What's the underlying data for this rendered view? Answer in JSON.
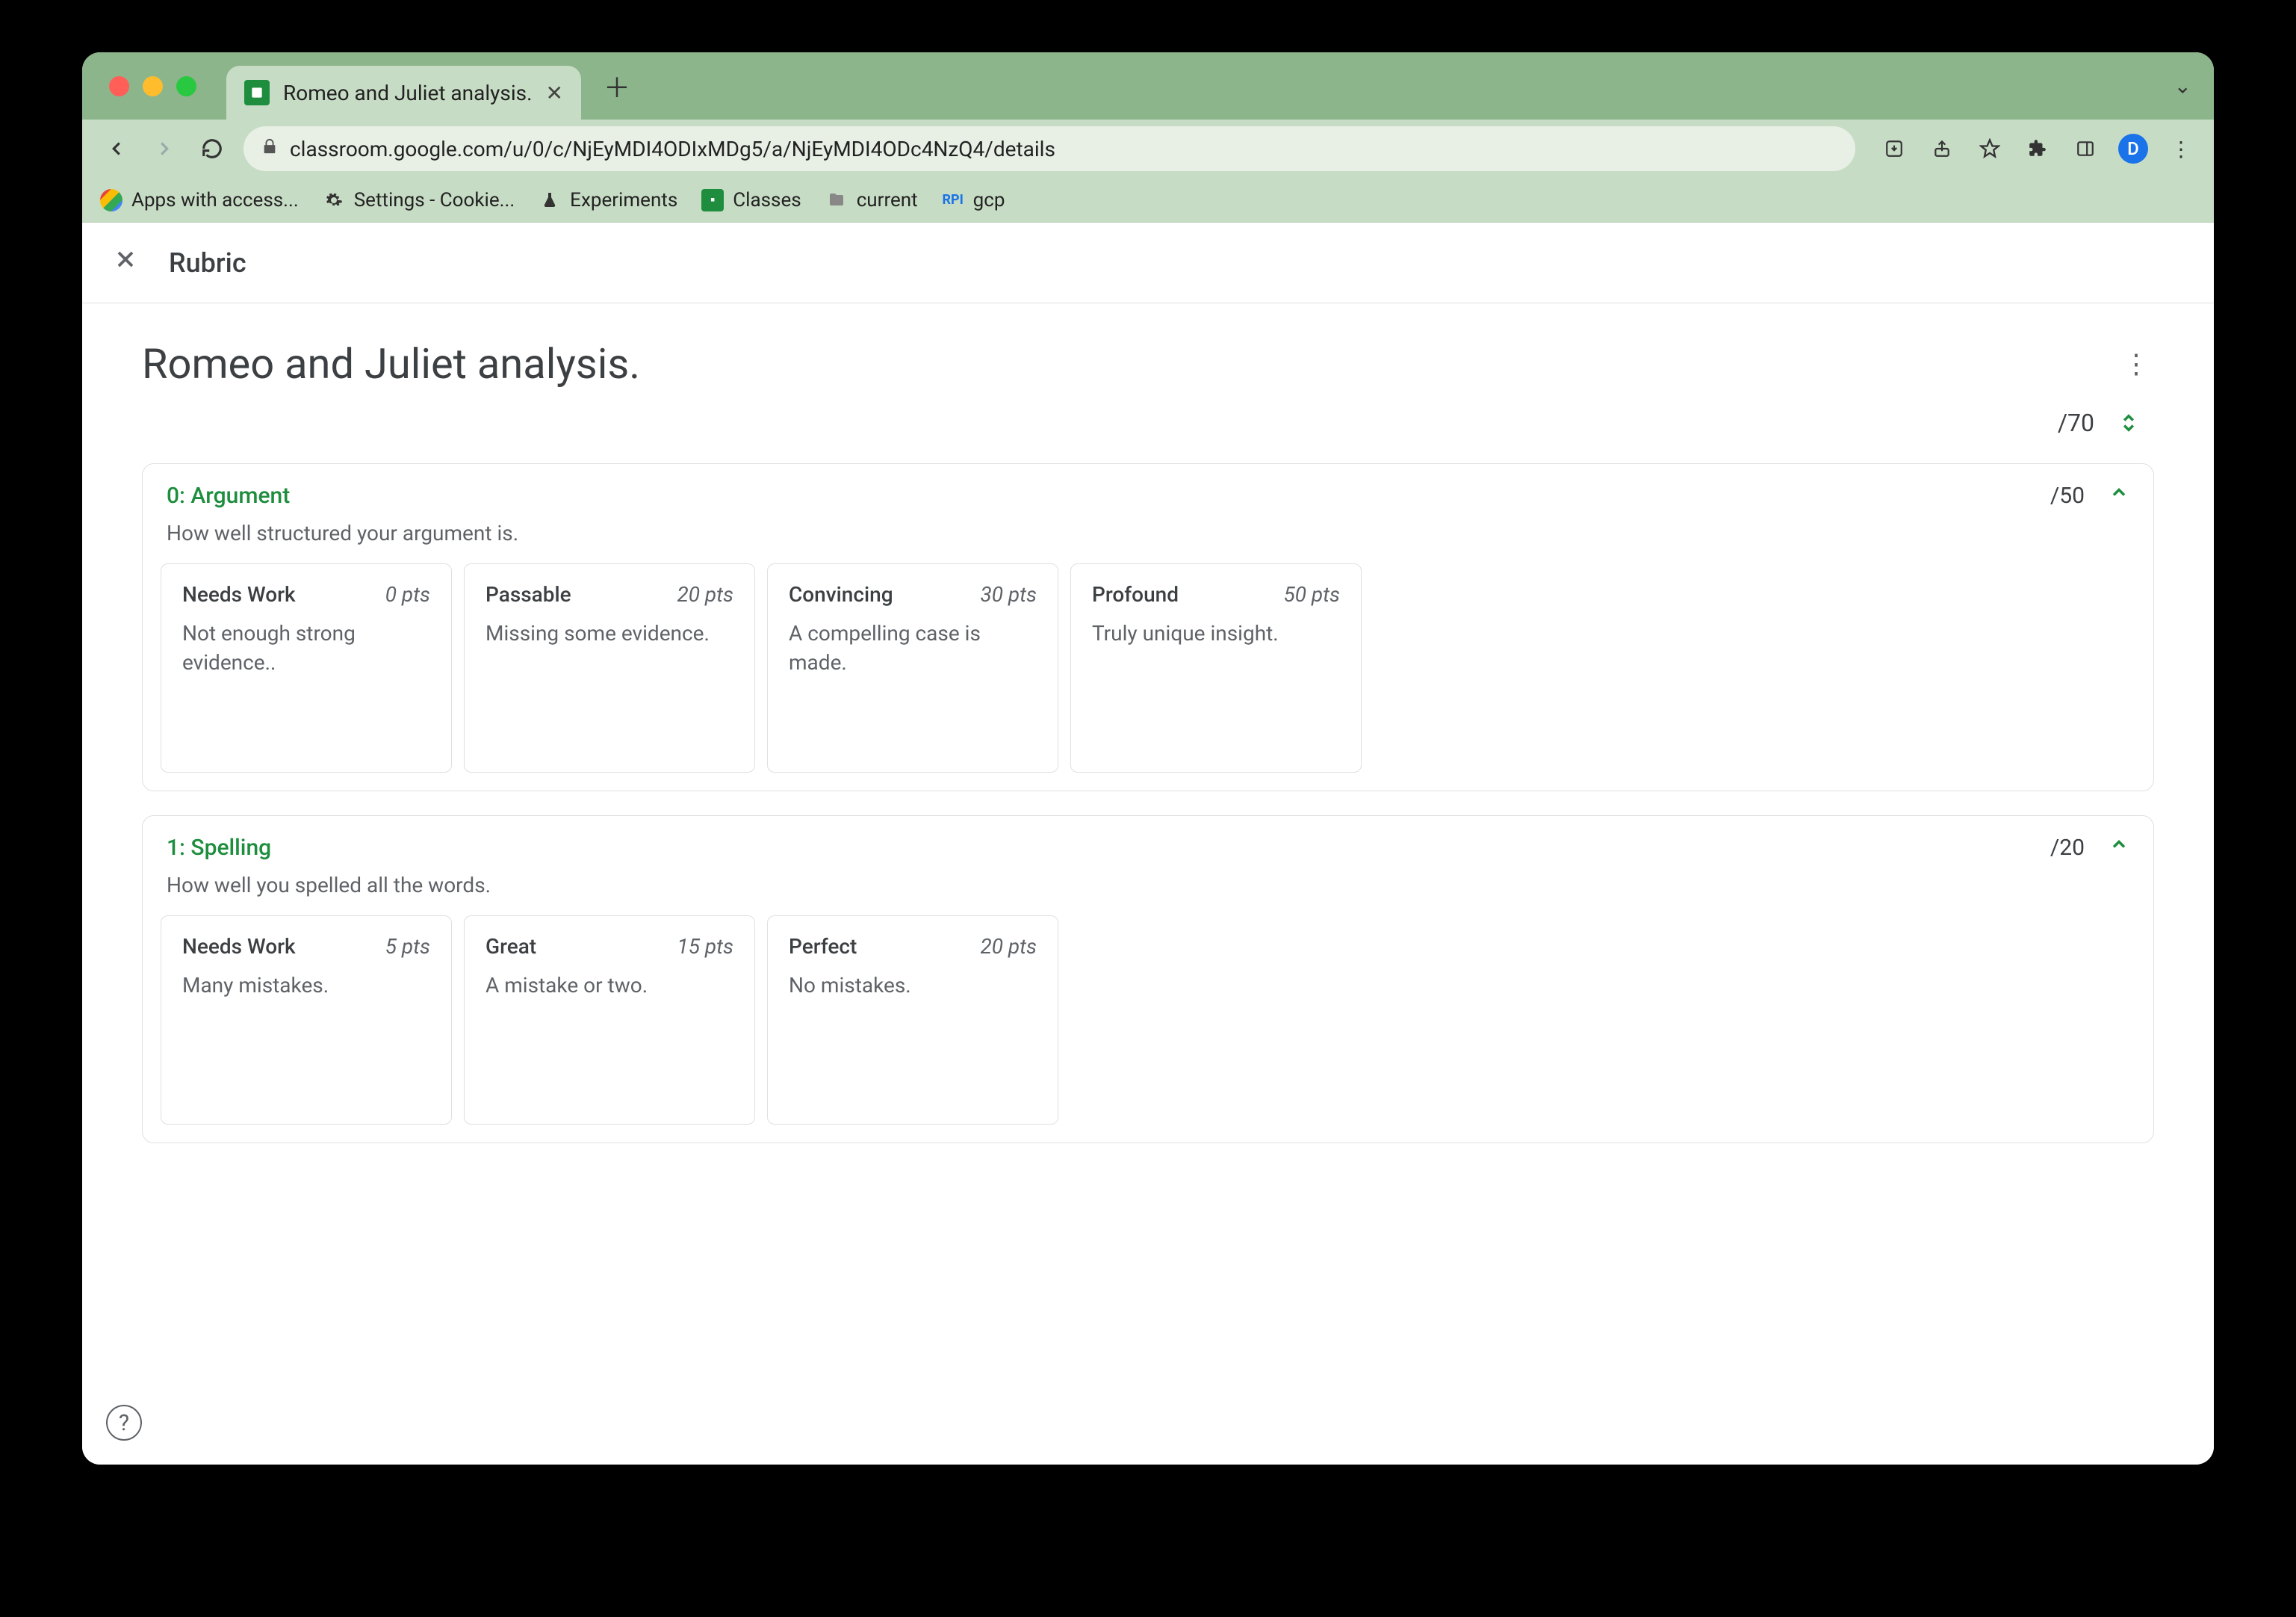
{
  "browser": {
    "tab_title": "Romeo and Juliet analysis.",
    "url": "classroom.google.com/u/0/c/NjEyMDI4ODIxMDg5/a/NjEyMDI4ODc4NzQ4/details",
    "avatar_letter": "D",
    "bookmarks": [
      {
        "label": "Apps with access...",
        "icon": "g"
      },
      {
        "label": "Settings - Cookie...",
        "icon": "gear"
      },
      {
        "label": "Experiments",
        "icon": "flask"
      },
      {
        "label": "Classes",
        "icon": "classroom"
      },
      {
        "label": "current",
        "icon": "folder"
      },
      {
        "label": "gcp",
        "icon": "api",
        "prefix": "RPI"
      }
    ]
  },
  "app": {
    "header_title": "Rubric",
    "page_title": "Romeo and Juliet analysis.",
    "total_points": "/70",
    "criteria": [
      {
        "index": 0,
        "title": "0: Argument",
        "points": "/50",
        "description": "How well structured your argument is.",
        "levels": [
          {
            "title": "Needs Work",
            "pts": "0 pts",
            "desc": "Not enough strong evidence.."
          },
          {
            "title": "Passable",
            "pts": "20 pts",
            "desc": "Missing some evidence."
          },
          {
            "title": "Convincing",
            "pts": "30 pts",
            "desc": "A compelling case is made."
          },
          {
            "title": "Profound",
            "pts": "50 pts",
            "desc": "Truly unique insight."
          }
        ]
      },
      {
        "index": 1,
        "title": "1: Spelling",
        "points": "/20",
        "description": "How well you spelled all the words.",
        "levels": [
          {
            "title": "Needs Work",
            "pts": "5 pts",
            "desc": "Many mistakes."
          },
          {
            "title": "Great",
            "pts": "15 pts",
            "desc": "A mistake or two."
          },
          {
            "title": "Perfect",
            "pts": "20 pts",
            "desc": "No mistakes."
          }
        ]
      }
    ]
  }
}
